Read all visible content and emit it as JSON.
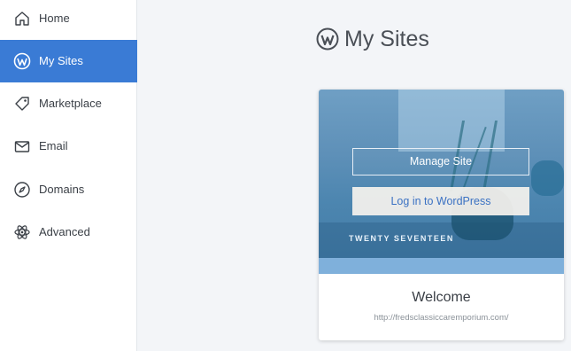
{
  "sidebar": {
    "items": [
      {
        "label": "Home",
        "icon": "home-icon"
      },
      {
        "label": "My Sites",
        "icon": "wordpress-icon",
        "active": true
      },
      {
        "label": "Marketplace",
        "icon": "tag-icon"
      },
      {
        "label": "Email",
        "icon": "mail-icon"
      },
      {
        "label": "Domains",
        "icon": "compass-icon"
      },
      {
        "label": "Advanced",
        "icon": "atom-icon"
      }
    ]
  },
  "main": {
    "title": "My Sites",
    "site_card": {
      "theme_name": "TWENTY SEVENTEEN",
      "manage_label": "Manage Site",
      "login_label": "Log in to WordPress",
      "site_title": "Welcome",
      "site_url": "http://fredsclassiccaremporium.com/"
    }
  },
  "colors": {
    "accent": "#3a7bd5",
    "background": "#f3f5f8",
    "link": "#3b72c3"
  }
}
